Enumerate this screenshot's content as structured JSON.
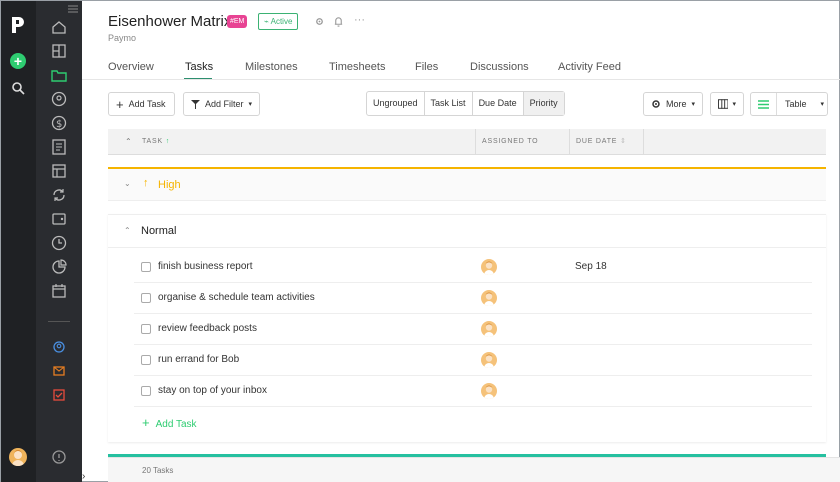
{
  "header": {
    "title": "Eisenhower Matrix",
    "tag": "#EM",
    "status": "Active",
    "subtitle": "Paymo"
  },
  "tabs": [
    "Overview",
    "Tasks",
    "Milestones",
    "Timesheets",
    "Files",
    "Discussions",
    "Activity Feed"
  ],
  "active_tab": "Tasks",
  "toolbar": {
    "add_task": "Add Task",
    "add_filter": "Add Filter",
    "group_by": [
      "Ungrouped",
      "Task List",
      "Due Date",
      "Priority"
    ],
    "group_selected": "Priority",
    "more": "More",
    "view": "Table"
  },
  "table": {
    "columns": [
      "TASK",
      "ASSIGNED TO",
      "DUE DATE"
    ]
  },
  "groups": {
    "high": {
      "label": "High",
      "color": "#f5b400"
    },
    "normal": {
      "label": "Normal"
    }
  },
  "tasks": [
    {
      "name": "finish business report",
      "due": "Sep 18"
    },
    {
      "name": "organise & schedule team activities",
      "due": ""
    },
    {
      "name": "review feedback posts",
      "due": ""
    },
    {
      "name": "run errand for Bob",
      "due": ""
    },
    {
      "name": "stay on top of your inbox",
      "due": ""
    }
  ],
  "add_task_inline": "Add Task",
  "footer": {
    "count": "20 Tasks"
  },
  "colors": {
    "accent": "#2ecc71",
    "rail": "#1f2124",
    "sidebar": "#2a2c30",
    "tag": "#e84393",
    "normal_bottom": "#26c0a0"
  }
}
